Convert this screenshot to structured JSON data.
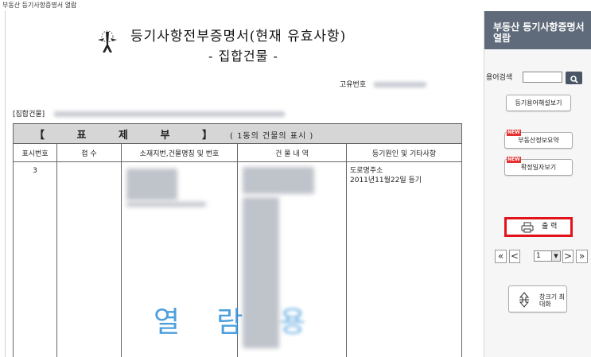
{
  "window": {
    "title": "부동산 등기사항증명서 열람"
  },
  "document": {
    "title": "등기사항전부증명서(현재 유효사항)",
    "subtitle": "- 집합건물 -",
    "unique_no_label": "고유번호",
    "building_label": "[집합건물]",
    "section": {
      "mark": "【 표 제 부 】",
      "description": "( 1동의 건물의 표시 )"
    },
    "table": {
      "headers": [
        "표시번호",
        "접 수",
        "소재지번,건물명칭 및 번호",
        "건 물 내 역",
        "등기원인 및 기타사항"
      ],
      "rows": [
        {
          "no": "3",
          "receipt": "",
          "cause_line1": "도로명주소",
          "cause_line2": "2011년11월22일  등기"
        }
      ]
    },
    "watermark": {
      "char1": "열",
      "char2": "람",
      "char3": "용"
    }
  },
  "panel": {
    "title": "부동산 등기사항증명서 열람",
    "search": {
      "label": "용어검색",
      "value": ""
    },
    "buttons": {
      "glossary": "등기용어해설보기",
      "summary": "부동산정보요약",
      "confirm": "확정일자보기",
      "print": "출 력",
      "maximize": "창크기 최대화",
      "new_badge": "NEW"
    },
    "pager": {
      "first": "«",
      "prev": "<",
      "page": "1",
      "next": ">",
      "last": "»"
    }
  },
  "colors": {
    "panel_header": "#5f6b7a",
    "print_border": "#e3131b",
    "watermark": "#2f8fd8",
    "table_header": "#d6d6d6"
  },
  "icons": [
    "court-emblem-icon",
    "search-icon",
    "printer-icon",
    "resize-arrows-icon",
    "dropdown-arrow-icon"
  ]
}
